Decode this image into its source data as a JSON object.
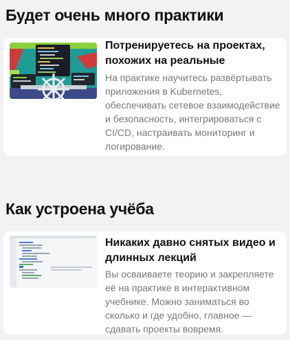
{
  "section1": {
    "title": "Будет очень много практики",
    "card": {
      "title": "Потренируетесь на проектах, похожих на реальные",
      "description": "На практике научитесь развёртывать приложения в Kubernetes, обеспечивать сетевое взаимодействие и безопасность, интегрироваться с CI/CD, настраивать мониторинг и логирование.",
      "image_icon": "ship-helm-illustration"
    }
  },
  "section2": {
    "title": "Как устроена учёба",
    "card": {
      "title": "Никаких давно снятых видео и длинных лекций",
      "description": "Вы осваиваете теорию и закрепляете её на практике в интерактивном учебнике. Можно заниматься во сколько и где удобно, главное — сдавать проекты вовремя.",
      "image_icon": "code-editor-screenshot"
    }
  },
  "colors": {
    "page_background": "#f2f2f4",
    "card_background": "#ffffff",
    "title_text": "#111111",
    "description_text": "#777777",
    "illustration_teal": "#1f9c96",
    "illustration_green": "#8bd03d",
    "illustration_red": "#d23a3a"
  }
}
